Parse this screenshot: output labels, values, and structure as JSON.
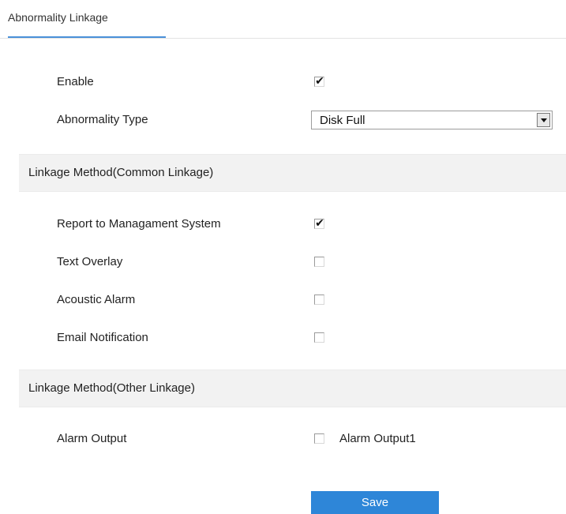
{
  "tabs": [
    {
      "label": "Abnormality Linkage",
      "active": true
    }
  ],
  "general": {
    "enable": {
      "label": "Enable",
      "checked": true
    },
    "abnormality_type": {
      "label": "Abnormality Type",
      "selected": "Disk Full",
      "icon": "chevron-down-icon"
    }
  },
  "common_linkage": {
    "title": "Linkage Method(Common Linkage)",
    "items": [
      {
        "label": "Report to Managament System",
        "checked": true
      },
      {
        "label": "Text Overlay",
        "checked": false
      },
      {
        "label": "Acoustic Alarm",
        "checked": false
      },
      {
        "label": "Email Notification",
        "checked": false
      }
    ]
  },
  "other_linkage": {
    "title": "Linkage Method(Other Linkage)",
    "alarm_output": {
      "label": "Alarm Output",
      "options": [
        {
          "label": "Alarm Output1",
          "checked": false
        }
      ]
    }
  },
  "actions": {
    "save_label": "Save"
  },
  "colors": {
    "accent": "#2e86d8",
    "tab_underline": "#4a90d9",
    "section_bg": "#f2f2f2"
  },
  "check_glyph": "✔"
}
